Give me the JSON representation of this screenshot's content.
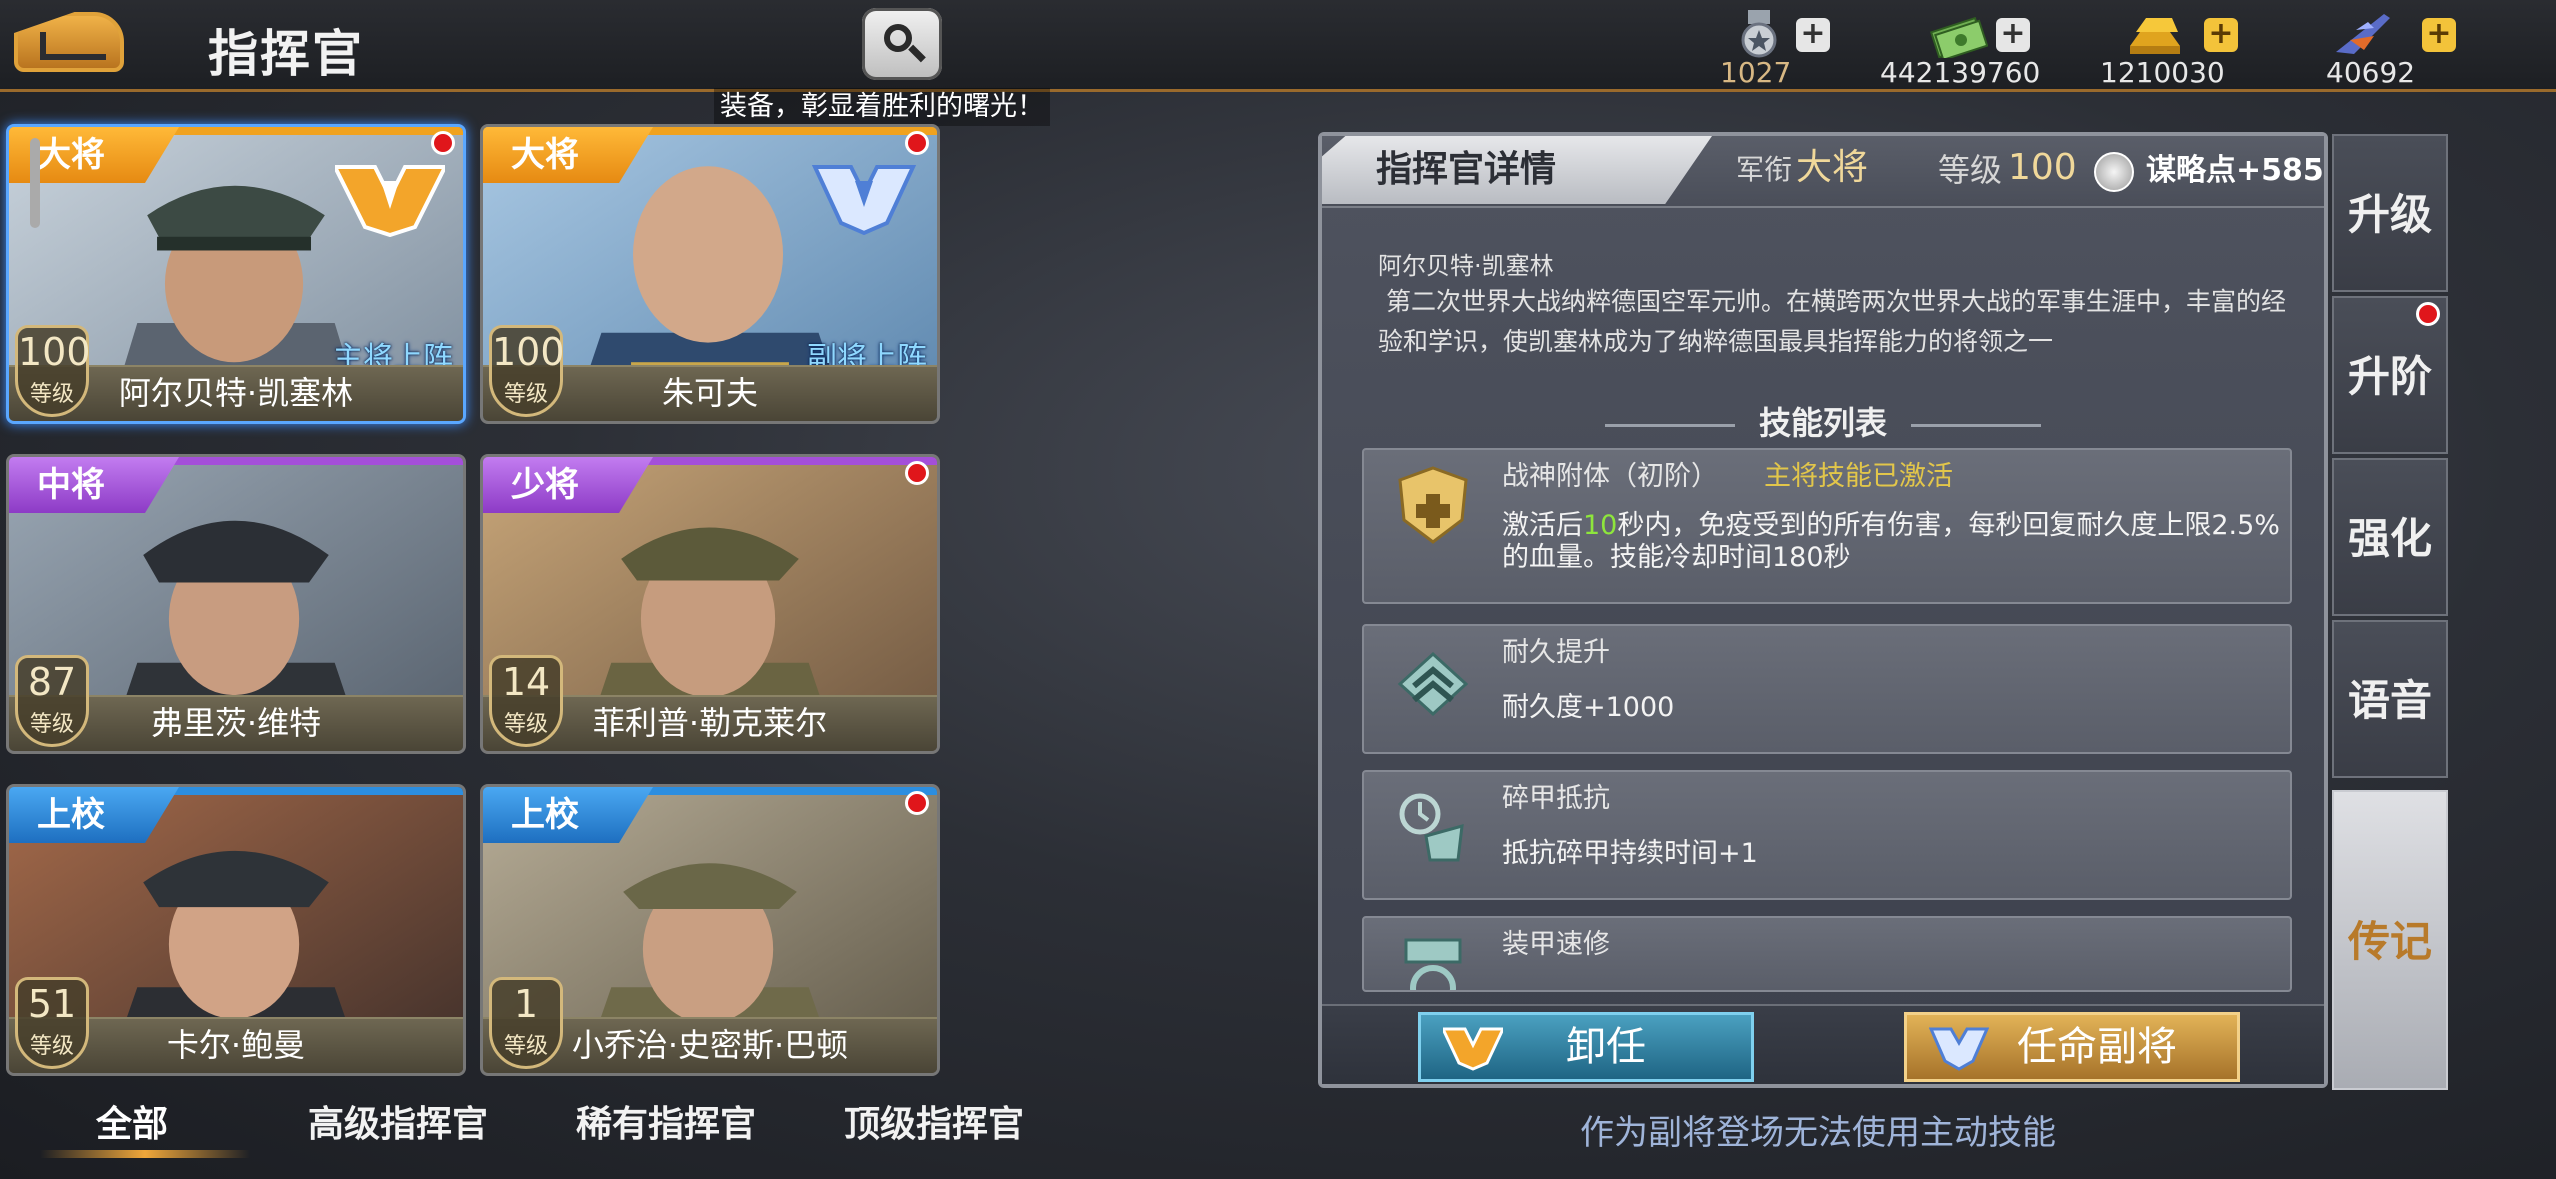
{
  "header": {
    "title": "指挥官",
    "marquee": "装备，彰显着胜利的曙光！",
    "resources": [
      {
        "icon": "medal-icon",
        "value": "1027",
        "color": "#d8b884"
      },
      {
        "icon": "cash-icon",
        "value": "442139760",
        "color": "#ffffff"
      },
      {
        "icon": "gold-bar-icon",
        "value": "1210030",
        "color": "#ffffff"
      },
      {
        "icon": "fighter-jet-icon",
        "value": "40692",
        "color": "#ffffff"
      }
    ]
  },
  "commanders": [
    {
      "rank": "大将",
      "name": "阿尔贝特·凯塞林",
      "level": "100",
      "level_label": "等级",
      "deploy": "主将上阵",
      "rank_color": "#f0a21f"
    },
    {
      "rank": "大将",
      "name": "朱可夫",
      "level": "100",
      "level_label": "等级",
      "deploy": "副将上阵",
      "rank_color": "#f0a21f"
    },
    {
      "rank": "中将",
      "name": "弗里茨·维特",
      "level": "87",
      "level_label": "等级",
      "deploy": "",
      "rank_color": "#a44fd9"
    },
    {
      "rank": "少将",
      "name": "菲利普·勒克莱尔",
      "level": "14",
      "level_label": "等级",
      "deploy": "",
      "rank_color": "#a44fd9"
    },
    {
      "rank": "上校",
      "name": "卡尔·鲍曼",
      "level": "51",
      "level_label": "等级",
      "deploy": "",
      "rank_color": "#2c8ee0"
    },
    {
      "rank": "上校",
      "name": "小乔治·史密斯·巴顿",
      "level": "1",
      "level_label": "等级",
      "deploy": "",
      "rank_color": "#2c8ee0"
    }
  ],
  "tabs": [
    "全部",
    "高级指挥官",
    "稀有指挥官",
    "顶级指挥官"
  ],
  "detail": {
    "title": "指挥官详情",
    "rank_label": "军衔",
    "rank_value": "大将",
    "level_label": "等级",
    "level_value": "100",
    "strategy": "谋略点+585",
    "bio_name": "阿尔贝特·凯塞林",
    "bio_text": "第二次世界大战纳粹德国空军元帅。在横跨两次世界大战的军事生涯中，丰富的经验和学识，使凯塞林成为了纳粹德国最具指挥能力的将领之一",
    "skills_title": "技能列表",
    "skills": [
      {
        "name": "战神附体（初阶）",
        "status": "主将技能已激活",
        "desc_pre": "激活后",
        "desc_hl": "10",
        "desc_post": "秒内，免疫受到的所有伤害，每秒回复耐久度上限2.5%的血量。技能冷却时间180秒"
      },
      {
        "name": "耐久提升",
        "desc": "耐久度+1000"
      },
      {
        "name": "碎甲抵抗",
        "desc": "抵抗碎甲持续时间+1"
      },
      {
        "name": "装甲速修",
        "desc": ""
      }
    ],
    "dismiss_label": "卸任",
    "appoint_label": "任命副将",
    "hint": "作为副将登场无法使用主动技能"
  },
  "side_tabs": [
    "升级",
    "升阶",
    "强化",
    "语音",
    "传记"
  ]
}
